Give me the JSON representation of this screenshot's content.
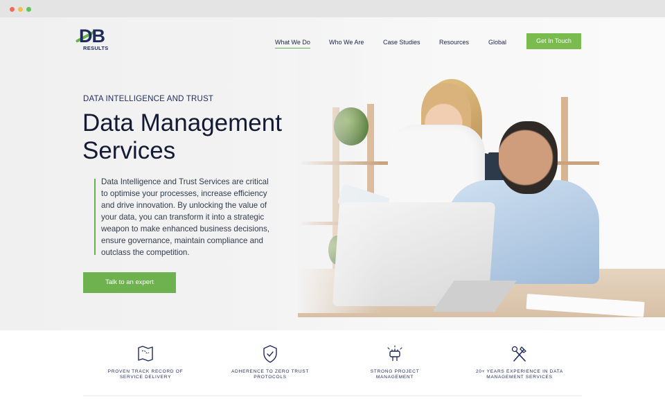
{
  "brand": {
    "logo_mark": "DB",
    "logo_sub": "RESULTS",
    "accent_color": "#6ab04c",
    "navy_color": "#1d2a5c"
  },
  "nav": {
    "items": [
      {
        "label": "What We Do",
        "active": true
      },
      {
        "label": "Who We Are",
        "active": false
      },
      {
        "label": "Case Studies",
        "active": false
      },
      {
        "label": "Resources",
        "active": false
      },
      {
        "label": "Global",
        "active": false
      }
    ],
    "cta_label": "Get In Touch"
  },
  "hero": {
    "eyebrow": "DATA INTELLIGENCE AND TRUST",
    "title_line1": "Data Management",
    "title_line2": "Services",
    "description": "Data Intelligence and Trust Services are critical to optimise your processes, increase efficiency and drive innovation. By unlocking the value of your data, you can transform it into a strategic weapon to make enhanced business decisions, ensure governance, maintain compliance and outclass the competition.",
    "cta_label": "Talk to an expert"
  },
  "features": [
    {
      "icon": "map-icon",
      "line1": "PROVEN TRACK RECORD OF",
      "line2": "SERVICE DELIVERY"
    },
    {
      "icon": "shield-check-icon",
      "line1": "ADHERENCE TO ZERO TRUST",
      "line2": "PROTOCOLS"
    },
    {
      "icon": "teamwork-icon",
      "line1": "STRONG PROJECT",
      "line2": "MANAGEMENT"
    },
    {
      "icon": "tools-icon",
      "line1": "20+ YEARS EXPERIENCE IN DATA",
      "line2": "MANAGEMENT SERVICES"
    }
  ]
}
